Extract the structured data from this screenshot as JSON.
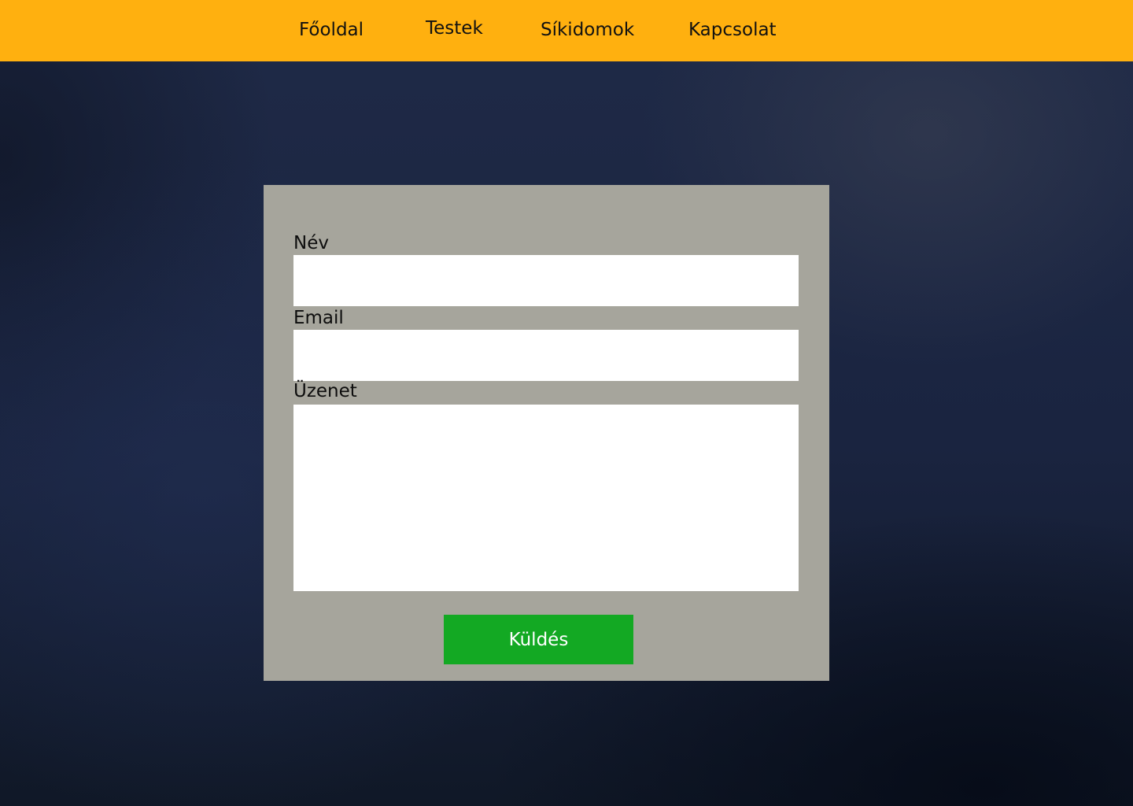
{
  "nav": {
    "items": [
      {
        "label": "Főoldal"
      },
      {
        "label": "Testek"
      },
      {
        "label": "Síkidomok"
      },
      {
        "label": "Kapcsolat"
      }
    ]
  },
  "form": {
    "name_label": "Név",
    "name_value": "",
    "email_label": "Email",
    "email_value": "",
    "message_label": "Üzenet",
    "message_value": "",
    "submit_label": "Küldés"
  },
  "colors": {
    "navbar": "#ffb00f",
    "card": "#a6a59c",
    "submit": "#13a923",
    "background": "#18223a"
  }
}
